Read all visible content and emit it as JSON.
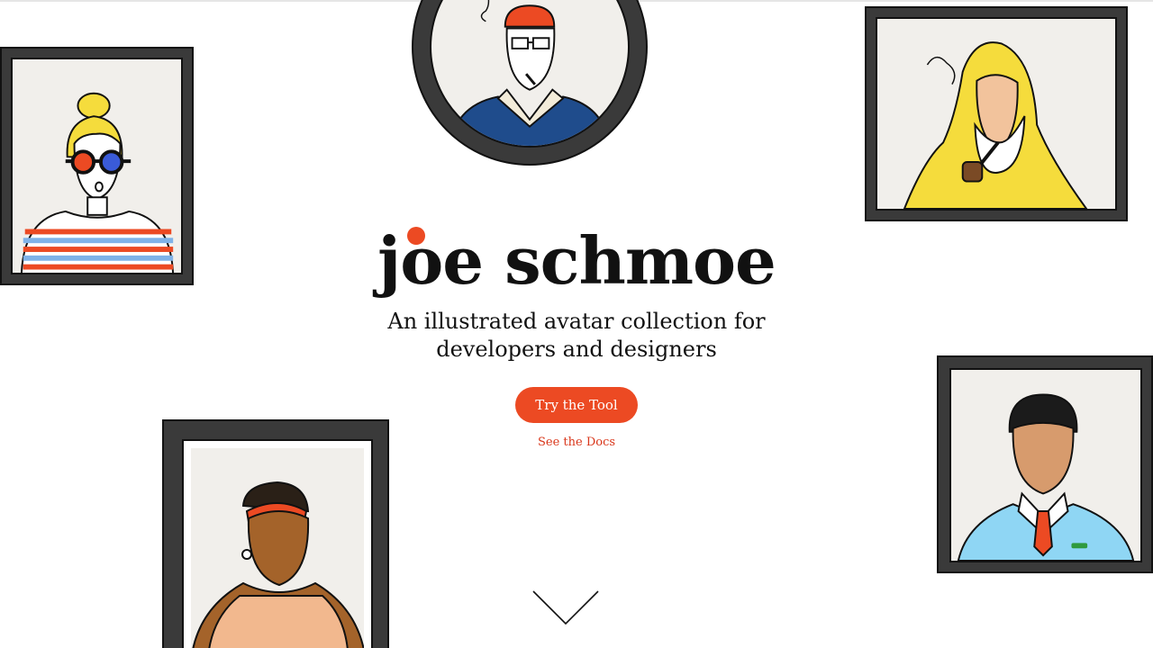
{
  "hero": {
    "title": "joe schmoe",
    "tagline_line1": "An illustrated avatar collection for",
    "tagline_line2": "developers and designers",
    "primary_button": "Try the Tool",
    "secondary_link": "See the Docs"
  },
  "colors": {
    "accent": "#ec4a23",
    "frame": "#3a3a3a",
    "mat": "#f1efeb"
  },
  "icons": {
    "scroll_down": "chevron-down-icon"
  },
  "avatars": [
    {
      "name": "avatar-blonde-sunglasses"
    },
    {
      "name": "avatar-glasses-beanie"
    },
    {
      "name": "avatar-fisherman-pipe"
    },
    {
      "name": "avatar-headband-woman"
    },
    {
      "name": "avatar-polo-man"
    }
  ]
}
